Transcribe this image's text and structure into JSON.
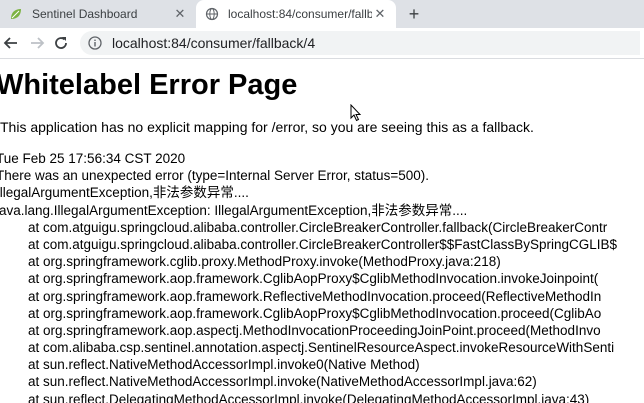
{
  "tabs": [
    {
      "title": "Sentinel Dashboard",
      "active": false
    },
    {
      "title": "localhost:84/consumer/fallbac",
      "active": true
    }
  ],
  "toolbar": {
    "url": "localhost:84/consumer/fallback/4"
  },
  "page": {
    "heading": "Whitelabel Error Page",
    "description": "This application has no explicit mapping for /error, so you are seeing this as a fallback.",
    "timestamp": "Tue Feb 25 17:56:34 CST 2020",
    "error_summary": "There was an unexpected error (type=Internal Server Error, status=500).",
    "message": "IllegalArgumentException,非法参数异常....",
    "exception": "java.lang.IllegalArgumentException: IllegalArgumentException,非法参数异常....",
    "stack": [
      "at com.atguigu.springcloud.alibaba.controller.CircleBreakerController.fallback(CircleBreakerContr",
      "at com.atguigu.springcloud.alibaba.controller.CircleBreakerController$$FastClassBySpringCGLIB$",
      "at org.springframework.cglib.proxy.MethodProxy.invoke(MethodProxy.java:218)",
      "at org.springframework.aop.framework.CglibAopProxy$CglibMethodInvocation.invokeJoinpoint(",
      "at org.springframework.aop.framework.ReflectiveMethodInvocation.proceed(ReflectiveMethodIn",
      "at org.springframework.aop.framework.CglibAopProxy$CglibMethodInvocation.proceed(CglibAo",
      "at org.springframework.aop.aspectj.MethodInvocationProceedingJoinPoint.proceed(MethodInvo",
      "at com.alibaba.csp.sentinel.annotation.aspectj.SentinelResourceAspect.invokeResourceWithSenti",
      "at sun.reflect.NativeMethodAccessorImpl.invoke0(Native Method)",
      "at sun.reflect.NativeMethodAccessorImpl.invoke(NativeMethodAccessorImpl.java:62)",
      "at sun.reflect.DelegatingMethodAccessorImpl.invoke(DelegatingMethodAccessorImpl.java:43)"
    ]
  },
  "colors": {
    "tabstrip": "#dee1e6",
    "sentinel_favicon": "#7cb342"
  }
}
